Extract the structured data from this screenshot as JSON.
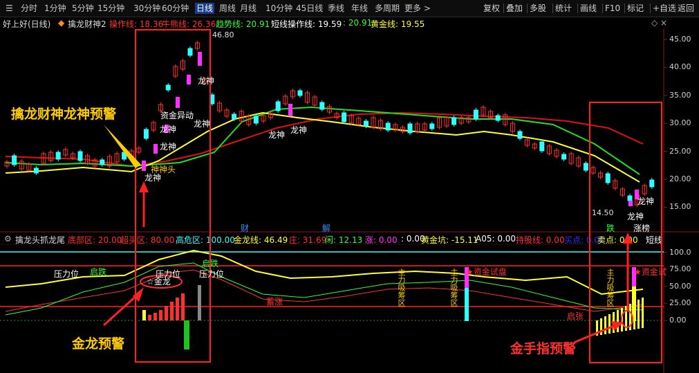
{
  "toolbar": {
    "items": [
      "分时",
      "1分钟",
      "5分钟",
      "15分钟",
      "30分钟",
      "60分钟",
      "日线",
      "周线",
      "月线",
      "10分钟",
      "45日线",
      "季线",
      "年线",
      "多周期",
      "更多 >"
    ],
    "active": "日线",
    "right_items": [
      "复权",
      "叠加",
      "多股",
      "统计",
      "画线",
      "F10",
      "标记",
      "+自选",
      "返回"
    ]
  },
  "main_panel": {
    "stock_title": "好上好(日线)",
    "indicator_name": "擒龙财神2",
    "lines": [
      {
        "label": "操作线: 18.36",
        "color": "#ff3030"
      },
      {
        "label": "牛熊线: 26.36",
        "color": "#ff3030"
      },
      {
        "label": "趋势线: 20.91",
        "color": "#30ff30"
      },
      {
        "label": "短线操作线: 19.59",
        "color": "#ffffff"
      },
      {
        "label": ": 20.91",
        "color": "#30ff30"
      },
      {
        "label": "黄金线: 19.55",
        "color": "#ffff30"
      }
    ],
    "price_axis": [
      "45.00",
      "40.00",
      "35.00",
      "30.00",
      "25.00",
      "20.00",
      "15.00"
    ],
    "high_label": "46.80",
    "low_label": "14.50",
    "markers": {
      "longshen": "龙神",
      "cai": "财",
      "jie": "解",
      "die": "跌",
      "zhangting": "涨榜",
      "shenshen": "神神头",
      "yinjin": "资金异动"
    }
  },
  "sub_panel": {
    "indicator_name": "擒龙头抓龙尾",
    "lines": [
      {
        "label": "底部区: 20.00",
        "color": "#ff3030"
      },
      {
        "label": "超买区: 80.00",
        "color": "#ff3030"
      },
      {
        "label": "高危区: 100.00",
        "color": "#30ffff"
      },
      {
        "label": "金龙线: 46.49",
        "color": "#ffff30"
      },
      {
        "label": "庄: 31.69",
        "color": "#ff3030"
      },
      {
        "label": "闲: 12.13",
        "color": "#30ff30"
      },
      {
        "label": "涨: 0.00",
        "color": "#ff30ff"
      },
      {
        "label": ": 0.00",
        "color": "#ffffff"
      },
      {
        "label": "黄金坑: -15.11",
        "color": "#ffff30"
      },
      {
        "label": "A05: 0.00",
        "color": "#ffffff"
      },
      {
        "label": "持股线: 0.00",
        "color": "#ff3030"
      },
      {
        "label": "买点: 0.00",
        "color": "#3030ff"
      },
      {
        "label": "卖点: 0.00",
        "color": "#ffff30"
      },
      {
        "label": "短线",
        "color": "#ffffff"
      }
    ],
    "axis": [
      "100.0",
      "75.00",
      "50.00",
      "25.00",
      "0.00"
    ],
    "labels": {
      "yali1": "压力位",
      "yali2": "压力位",
      "yali3": "压力位",
      "qidie1": "启跌",
      "qidie2": "启跌",
      "jinlong": "☆金龙",
      "zhuli1": "主力吸筹区",
      "zhuli2": "主力吸筹区",
      "zhuli3": "主力吸筹区",
      "zijin1": "★资金试盘",
      "zijin2": "★资金试",
      "jiangjiang": "蓄涨",
      "jianfa": "启张"
    }
  },
  "annotations": {
    "qinlong": "擒龙财神龙神预警",
    "jinlong": "金龙预警",
    "jinshouzhi": "金手指预警"
  },
  "colors": {
    "up": "#ff3030",
    "down": "#30ffff",
    "ma_red": "#e01010",
    "ma_yellow": "#ffff30",
    "ma_green": "#20e020",
    "accent": "#ff2020",
    "anno_yellow": "#ffcc00"
  }
}
